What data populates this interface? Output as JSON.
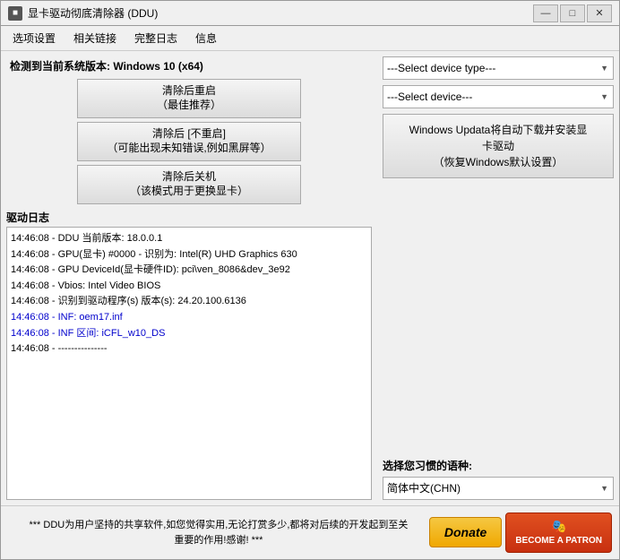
{
  "titlebar": {
    "icon": "■",
    "text": "显卡驱动彻底清除器 (DDU)",
    "minimize": "—",
    "maximize": "□",
    "close": "✕"
  },
  "menubar": {
    "items": [
      "选项设置",
      "相关链接",
      "完整日志",
      "信息"
    ]
  },
  "left": {
    "system_version_label": "检测到当前系统版本:",
    "system_version": "Windows 10 (x64)",
    "buttons": [
      {
        "line1": "清除后重启",
        "line2": "（最佳推荐）"
      },
      {
        "line1": "清除后 [不重启]",
        "line2": "（可能出现未知错误,例如黑屏等）"
      },
      {
        "line1": "清除后关机",
        "line2": "（该模式用于更换显卡）"
      }
    ],
    "log_title": "驱动日志",
    "log_entries": [
      {
        "text": "14:46:08 - DDU 当前版本: 18.0.0.1",
        "color": "normal"
      },
      {
        "text": "14:46:08 - GPU(显卡) #0000 - 识别为: Intel(R) UHD Graphics 630",
        "color": "normal"
      },
      {
        "text": "14:46:08 - GPU DeviceId(显卡硬件ID): pci\\ven_8086&dev_3e92",
        "color": "normal"
      },
      {
        "text": "14:46:08 - Vbios: Intel Video BIOS",
        "color": "normal"
      },
      {
        "text": "14:46:08 - 识别到驱动程序(s) 版本(s): 24.20.100.6136",
        "color": "normal"
      },
      {
        "text": "14:46:08 - INF: oem17.inf",
        "color": "blue"
      },
      {
        "text": "14:46:08 - INF 区间: iCFL_w10_DS",
        "color": "blue"
      },
      {
        "text": "14:46:08 - ---------------",
        "color": "normal"
      }
    ]
  },
  "right": {
    "device_type_placeholder": "---Select device type---",
    "device_placeholder": "---Select device---",
    "windows_update_line1": "Windows Updata将自动下载并安装显",
    "windows_update_line2": "卡驱动",
    "windows_update_line3": "（恢复Windows默认设置）",
    "language_label": "选择您习惯的语种:",
    "language_selected": "简体中文(CHN)"
  },
  "bottom": {
    "text_line1": "*** DDU为用户坚持的共享软件,如您觉得实用,无论打赏多少,都将对后续的开发起到至关",
    "text_line2": "重要的作用!感谢! ***",
    "donate_label": "Donate",
    "patron_icon": "🎭",
    "patron_label": "BECOME A PATRON"
  }
}
